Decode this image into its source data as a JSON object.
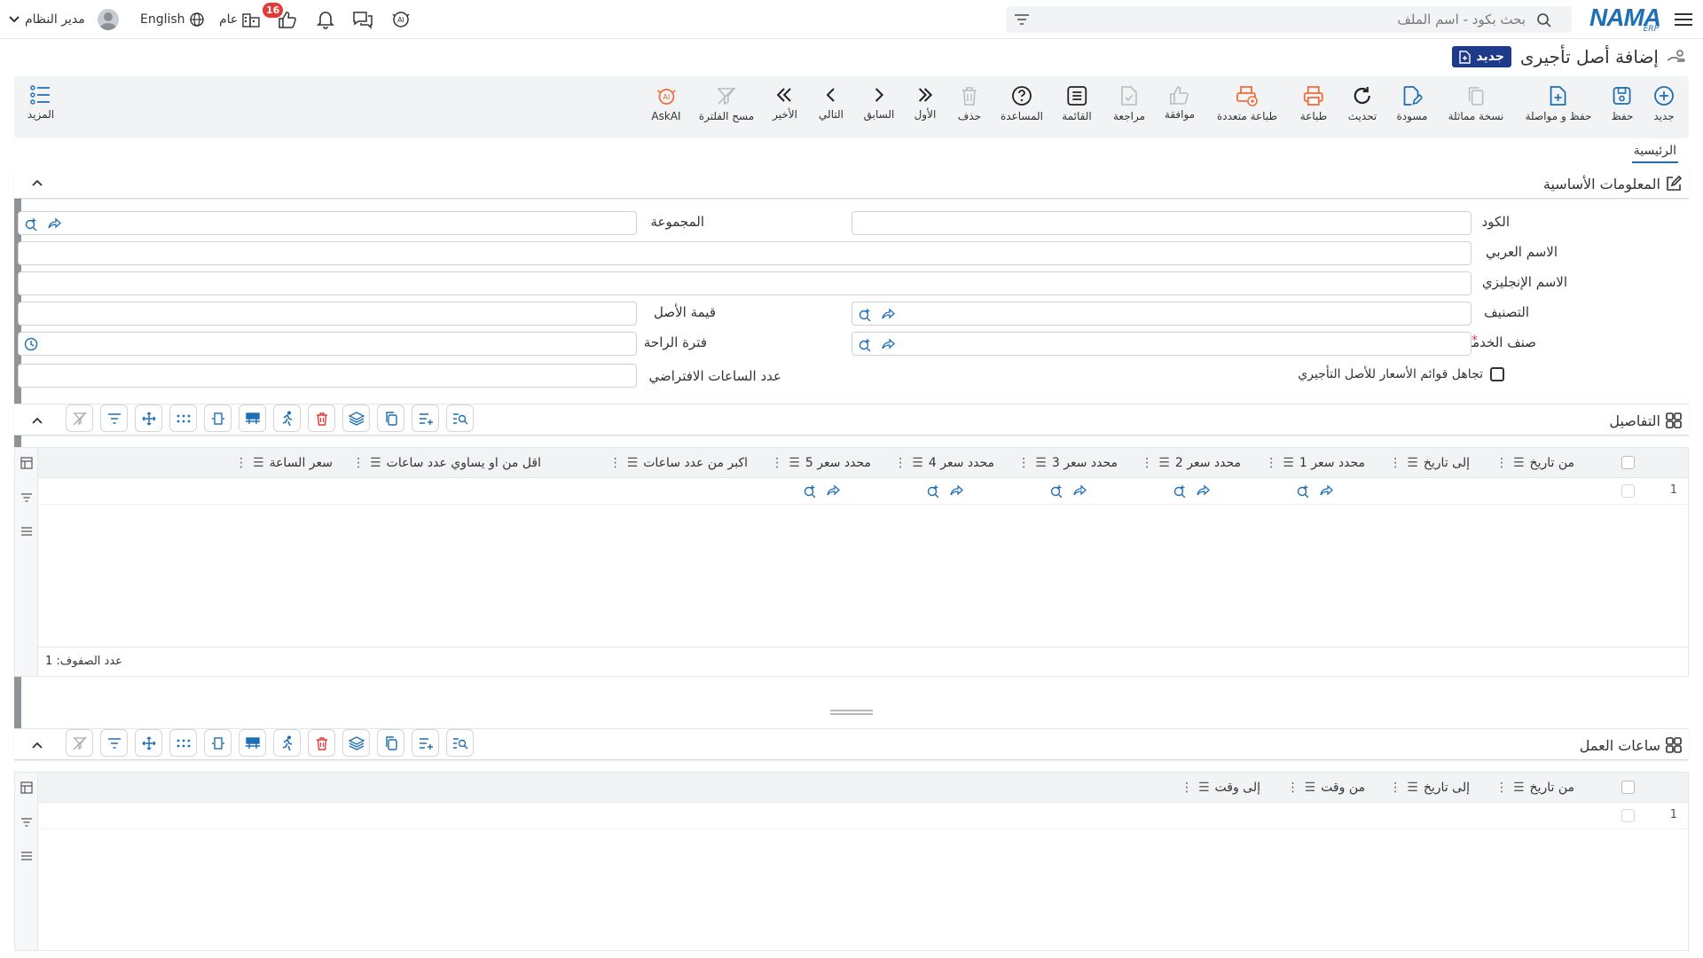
{
  "topbar": {
    "search_placeholder": "بحث بكود - اسم الملف",
    "logo_text": "NAMA",
    "logo_sub": "ERP",
    "user_name": "مدير النظام",
    "language": "English",
    "general_label": "عام",
    "notif_count": "16"
  },
  "page": {
    "title": "إضافة أصل تأجيرى",
    "badge": "جديد"
  },
  "toolbar": {
    "items": [
      {
        "label": "جديد",
        "icon": "plus-circle-icon"
      },
      {
        "label": "حفظ",
        "icon": "save-icon"
      },
      {
        "label": "حفظ و مواصلة",
        "icon": "file-plus-icon"
      },
      {
        "label": "نسخة مماثلة",
        "icon": "copy-icon"
      },
      {
        "label": "مسودة",
        "icon": "draft-icon"
      },
      {
        "label": "تحديث",
        "icon": "refresh-icon"
      },
      {
        "label": "طباعة",
        "icon": "printer-icon"
      },
      {
        "label": "طباعة متعددة",
        "icon": "multi-print-icon"
      },
      {
        "label": "موافقة",
        "icon": "thumbs-up-icon"
      },
      {
        "label": "مراجعة",
        "icon": "review-icon"
      },
      {
        "label": "القائمة",
        "icon": "list-icon"
      },
      {
        "label": "المساعدة",
        "icon": "help-icon"
      },
      {
        "label": "حذف",
        "icon": "trash-icon"
      },
      {
        "label": "الأول",
        "icon": "first-icon"
      },
      {
        "label": "السابق",
        "icon": "prev-icon"
      },
      {
        "label": "التالي",
        "icon": "next-icon"
      },
      {
        "label": "الأخير",
        "icon": "last-icon"
      },
      {
        "label": "مسح الفلترة",
        "icon": "clear-filter-icon"
      },
      {
        "label": "AskAI",
        "icon": "ai-icon"
      }
    ],
    "more_label": "المزيد"
  },
  "tabs": {
    "main": "الرئيسية"
  },
  "basic_info": {
    "title": "المعلومات الأساسية",
    "code_label": "الكود",
    "group_label": "المجموعة",
    "arabic_name_label": "الاسم العربي",
    "english_name_label": "الاسم الإنجليزي",
    "category_label": "التصنيف",
    "asset_value_label": "قيمة الأصل",
    "service_class_label": "صنف الخدمة",
    "required_mark": "*",
    "rest_period_label": "فترة الراحة",
    "default_hours_label": "عدد الساعات الافتراضي",
    "ignore_price_lists_label": "تجاهل قوائم الأسعار للأصل التأجيري"
  },
  "details": {
    "title": "التفاصيل",
    "columns": [
      "من تاريخ",
      "إلى تاريخ",
      "محدد سعر 1",
      "محدد سعر 2",
      "محدد سعر 3",
      "محدد سعر 4",
      "محدد سعر 5",
      "اكبر من عدد ساعات",
      "اقل من او يساوي عدد ساعات",
      "سعر الساعة"
    ],
    "row_number": "1",
    "row_count": "عدد الصفوف: 1"
  },
  "work_hours": {
    "title": "ساعات العمل",
    "columns": [
      "من تاريخ",
      "إلى تاريخ",
      "من وقت",
      "إلى وقت"
    ],
    "row_number": "1"
  },
  "colors": {
    "primary": "#1f6fb5",
    "badge_bg": "#1e3a8a",
    "orange": "#f26b3a",
    "red_badge": "#e53935"
  }
}
